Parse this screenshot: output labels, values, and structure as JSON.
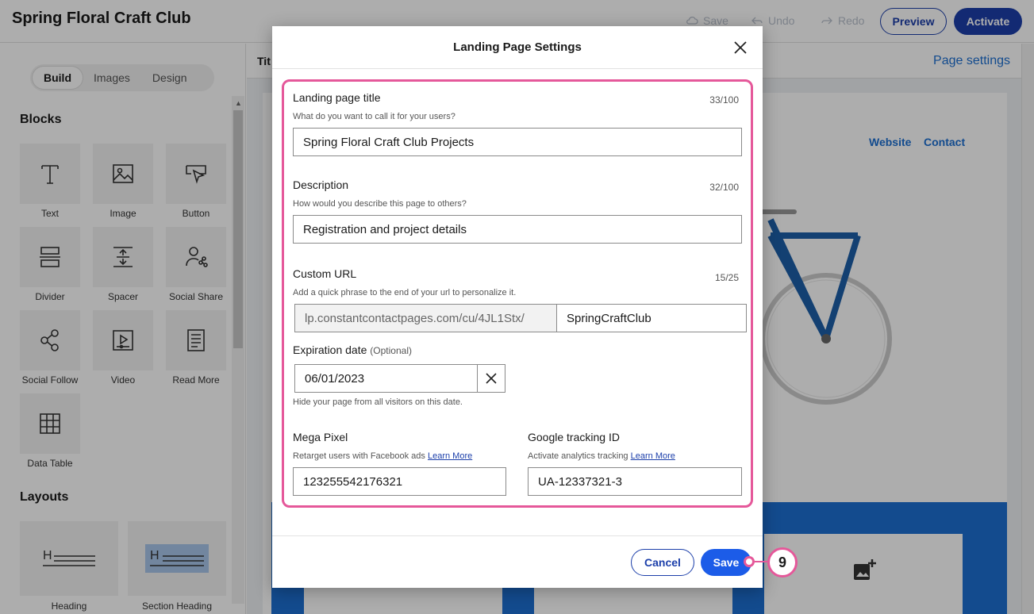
{
  "app": {
    "title": "Spring Floral Craft Club",
    "toolbar": {
      "save": "Save",
      "undo": "Undo",
      "redo": "Redo",
      "preview": "Preview",
      "activate": "Activate"
    }
  },
  "sidebar": {
    "tabs": [
      "Build",
      "Images",
      "Design"
    ],
    "active_tab": "Build",
    "blocks_heading": "Blocks",
    "blocks": [
      {
        "label": "Text",
        "icon": "text-icon"
      },
      {
        "label": "Image",
        "icon": "image-icon"
      },
      {
        "label": "Button",
        "icon": "button-icon"
      },
      {
        "label": "Divider",
        "icon": "divider-icon"
      },
      {
        "label": "Spacer",
        "icon": "spacer-icon"
      },
      {
        "label": "Social Share",
        "icon": "social-share-icon"
      },
      {
        "label": "Social Follow",
        "icon": "social-follow-icon"
      },
      {
        "label": "Video",
        "icon": "video-icon"
      },
      {
        "label": "Read More",
        "icon": "read-more-icon"
      },
      {
        "label": "Data Table",
        "icon": "data-table-icon"
      }
    ],
    "layouts_heading": "Layouts",
    "layouts": [
      {
        "label": "Heading"
      },
      {
        "label": "Section Heading"
      }
    ]
  },
  "canvas": {
    "title_partial": "Tit",
    "page_settings_link": "Page settings",
    "nav": [
      "Website",
      "Contact"
    ]
  },
  "modal": {
    "title": "Landing Page Settings",
    "landing_title": {
      "label": "Landing page title",
      "help": "What do you want to call it for your users?",
      "value": "Spring Floral Craft Club Projects",
      "count": "33/100"
    },
    "description": {
      "label": "Description",
      "help": "How would you describe this page to others?",
      "value": "Registration and project details",
      "count": "32/100"
    },
    "custom_url": {
      "label": "Custom URL",
      "help": "Add a quick phrase to the end of your url to personalize it.",
      "prefix": "lp.constantcontactpages.com/cu/4JL1Stx/",
      "value": "SpringCraftClub",
      "count": "15/25"
    },
    "expiration": {
      "label": "Expiration date",
      "optional": "(Optional)",
      "value": "06/01/2023",
      "help": "Hide your page from all visitors on this date."
    },
    "mega_pixel": {
      "label": "Mega Pixel",
      "help": "Retarget users with Facebook ads",
      "link": "Learn More",
      "value": "123255542176321"
    },
    "google": {
      "label": "Google tracking ID",
      "help": "Activate analytics tracking",
      "link": "Learn More",
      "value": "UA-12337321-3"
    },
    "cancel": "Cancel",
    "save": "Save"
  },
  "callout": {
    "number": "9",
    "color": "#e5589a"
  },
  "colors": {
    "primary": "#1c3faa",
    "link": "#1c6fd1",
    "highlight": "#e5589a"
  }
}
